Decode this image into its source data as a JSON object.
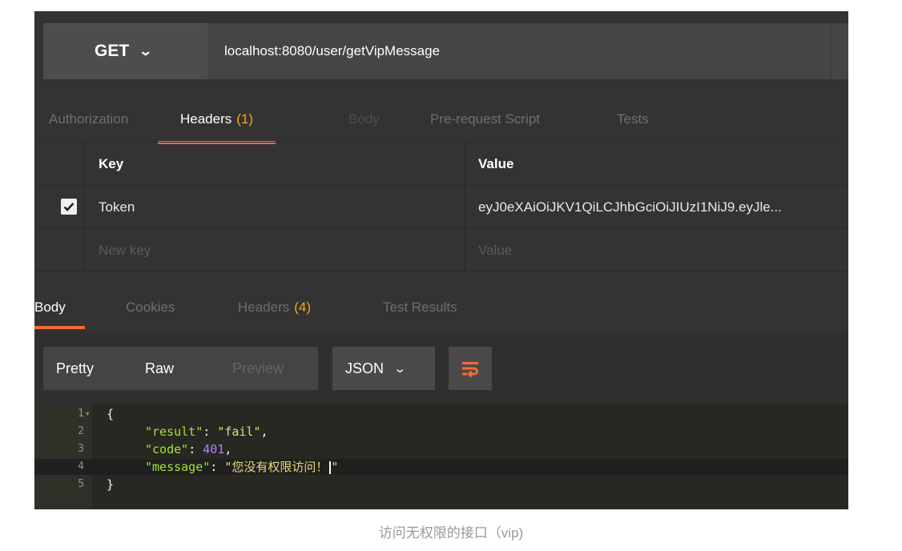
{
  "request": {
    "method": "GET",
    "url": "localhost:8080/user/getVipMessage"
  },
  "request_tabs": [
    {
      "label": "Authorization",
      "count": ""
    },
    {
      "label": "Headers",
      "count": "(1)"
    },
    {
      "label": "Body",
      "count": ""
    },
    {
      "label": "Pre-request Script",
      "count": ""
    },
    {
      "label": "Tests",
      "count": ""
    }
  ],
  "headers_table": {
    "key_header": "Key",
    "value_header": "Value",
    "rows": [
      {
        "key": "Token",
        "value": "eyJ0eXAiOiJKV1QiLCJhbGciOiJIUzI1NiJ9.eyJle...",
        "checked": true
      }
    ],
    "new_key_placeholder": "New key",
    "new_value_placeholder": "Value"
  },
  "response_tabs": [
    {
      "label": "Body",
      "count": ""
    },
    {
      "label": "Cookies",
      "count": ""
    },
    {
      "label": "Headers",
      "count": "(4)"
    },
    {
      "label": "Test Results",
      "count": ""
    }
  ],
  "view_modes": [
    "Pretty",
    "Raw",
    "Preview"
  ],
  "format": "JSON",
  "code_lines": [
    {
      "num": "1",
      "text": "{"
    },
    {
      "num": "2",
      "key": "\"result\"",
      "sep": ": ",
      "value": "\"fail\"",
      "tail": ","
    },
    {
      "num": "3",
      "key": "\"code\"",
      "sep": ": ",
      "value": "401",
      "tail": ","
    },
    {
      "num": "4",
      "key": "\"message\"",
      "sep": ": ",
      "value": "\"您没有权限访问！",
      "tail": "\""
    },
    {
      "num": "5",
      "text": "}"
    }
  ],
  "caption": "访问无权限的接口（vip)",
  "colors": {
    "accent_orange": "#f26b3a",
    "count_yellow": "#f1a91d",
    "json_key": "#a6e22e",
    "json_string": "#e6db74",
    "json_number": "#ae81ff"
  }
}
